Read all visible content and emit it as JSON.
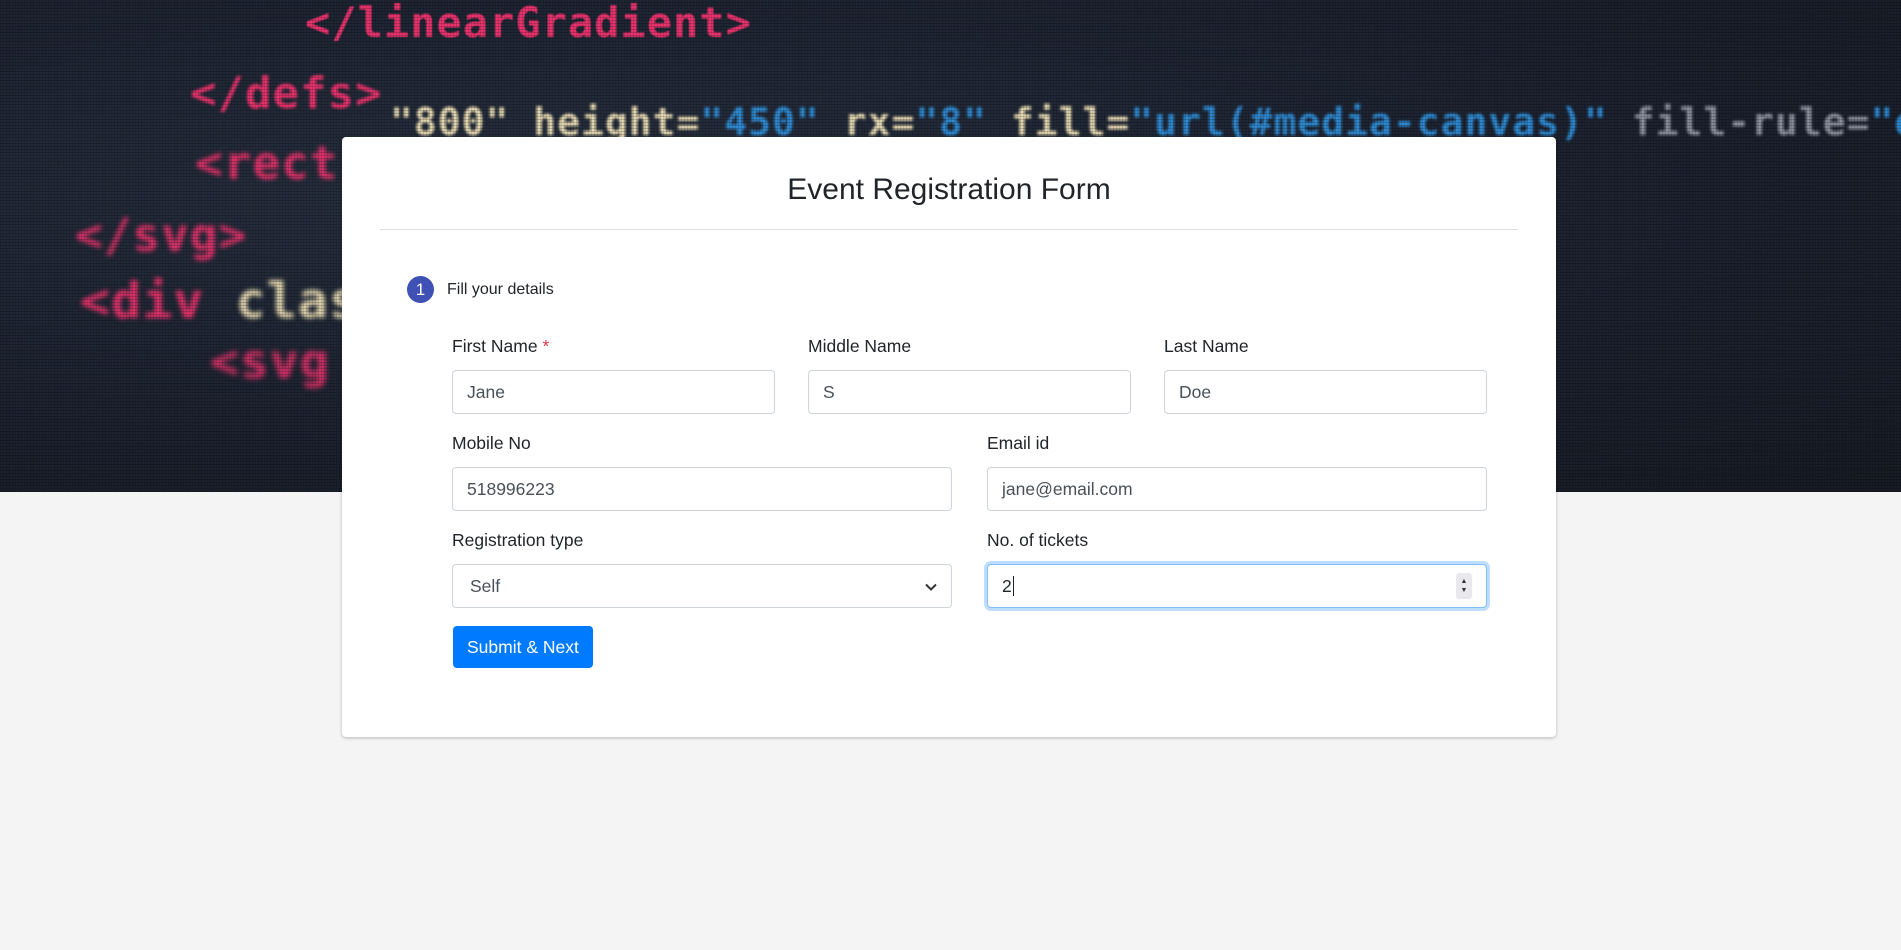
{
  "hero": {
    "code_lines": [
      {
        "parts": [
          {
            "text": "</linearGradient>",
            "cls": "c-pink"
          }
        ]
      },
      {
        "parts": [
          {
            "text": "</defs>",
            "cls": "c-pink"
          }
        ]
      },
      {
        "parts": [
          {
            "text": "\"800\" height=",
            "cls": "c-cream"
          },
          {
            "text": "\"450\"",
            "cls": "c-blue"
          },
          {
            "text": " rx=",
            "cls": "c-cream"
          },
          {
            "text": "\"8\"",
            "cls": "c-blue"
          },
          {
            "text": " fill=",
            "cls": "c-cream"
          },
          {
            "text": "\"url(#media-canvas)\"",
            "cls": "c-blue"
          },
          {
            "text": " fill-rule=",
            "cls": "c-gray"
          },
          {
            "text": "\"evenodd\"",
            "cls": "c-blue"
          }
        ]
      },
      {
        "parts": [
          {
            "text": "<rect",
            "cls": "c-pink"
          }
        ]
      },
      {
        "parts": [
          {
            "text": "</svg>",
            "cls": "c-pink"
          }
        ]
      },
      {
        "parts": [
          {
            "text": "<div ",
            "cls": "c-pink"
          },
          {
            "text": "class",
            "cls": "c-cream"
          }
        ]
      },
      {
        "parts": [
          {
            "text": "<svg",
            "cls": "c-pink"
          }
        ]
      }
    ]
  },
  "form": {
    "title": "Event Registration Form",
    "step": {
      "number": "1",
      "label": "Fill your details"
    },
    "first_name": {
      "label": "First Name",
      "required_mark": "*",
      "value": "Jane"
    },
    "middle_name": {
      "label": "Middle Name",
      "value": "S"
    },
    "last_name": {
      "label": "Last Name",
      "value": "Doe"
    },
    "mobile": {
      "label": "Mobile No",
      "value": "518996223"
    },
    "email": {
      "label": "Email id",
      "value": "jane@email.com"
    },
    "registration_type": {
      "label": "Registration type",
      "selected": "Self"
    },
    "tickets": {
      "label": "No. of tickets",
      "value": "2"
    },
    "submit_label": "Submit & Next"
  }
}
